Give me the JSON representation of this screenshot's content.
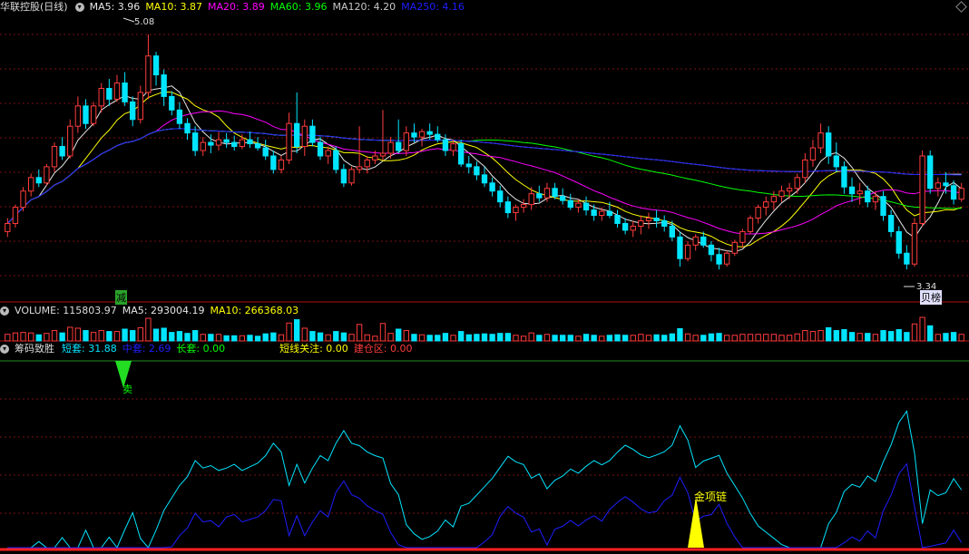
{
  "header": {
    "stock_name": "华联控股(日线)",
    "ma5_label": "MA5: 3.96",
    "ma10_label": "MA10: 3.87",
    "ma20_label": "MA20: 3.89",
    "ma60_label": "MA60: 3.96",
    "ma120_label": "MA120: 4.20",
    "ma250_label": "MA250: 4.16"
  },
  "price_panel": {
    "high_label": "5.08",
    "low_label": "3.34",
    "sell_marker_label": "减",
    "buy_marker_label": "贝榜"
  },
  "volume_panel": {
    "volume_label": "VOLUME: 115803.97",
    "ma5_label": "MA5: 293004.19",
    "ma10_label": "MA10: 266368.03"
  },
  "indicator_panel": {
    "name": "筹码致胜",
    "short_label": "短套: 31.88",
    "mid_label": "中套: 2.69",
    "long_label": "长套: 0.00",
    "focus_label": "短线关注: 0.00",
    "build_label": "建仓区: 0.00",
    "sell_signal_label": "卖",
    "golden_label": "金项链"
  },
  "colors": {
    "up": "#ff3c3c",
    "down": "#00e5ff",
    "ma5": "#e6e6e6",
    "ma10": "#ffff00",
    "ma20": "#ff00ff",
    "ma60": "#00ff00",
    "ma120": "#c8c8c8",
    "ma250": "#1e1eff",
    "short": "#00e5ff",
    "mid": "#1e1eff",
    "long": "#00ff00"
  },
  "chart_data": {
    "type": "candlestick",
    "ylim": [
      3.2,
      5.2
    ],
    "ohlc": [
      [
        3.62,
        3.72,
        3.58,
        3.68
      ],
      [
        3.68,
        3.82,
        3.65,
        3.8
      ],
      [
        3.8,
        3.95,
        3.77,
        3.92
      ],
      [
        3.92,
        4.05,
        3.88,
        4.02
      ],
      [
        4.02,
        4.08,
        3.95,
        3.98
      ],
      [
        3.98,
        4.12,
        3.96,
        4.1
      ],
      [
        4.1,
        4.28,
        4.06,
        4.25
      ],
      [
        4.25,
        4.32,
        4.15,
        4.18
      ],
      [
        4.18,
        4.45,
        4.16,
        4.4
      ],
      [
        4.4,
        4.62,
        4.35,
        4.55
      ],
      [
        4.55,
        4.6,
        4.38,
        4.42
      ],
      [
        4.42,
        4.58,
        4.4,
        4.55
      ],
      [
        4.55,
        4.72,
        4.5,
        4.68
      ],
      [
        4.68,
        4.75,
        4.55,
        4.6
      ],
      [
        4.6,
        4.78,
        4.58,
        4.72
      ],
      [
        4.72,
        4.8,
        4.55,
        4.58
      ],
      [
        4.58,
        4.62,
        4.4,
        4.45
      ],
      [
        4.45,
        4.7,
        4.42,
        4.65
      ],
      [
        4.65,
        5.08,
        4.6,
        4.92
      ],
      [
        4.92,
        4.95,
        4.7,
        4.78
      ],
      [
        4.78,
        4.82,
        4.55,
        4.62
      ],
      [
        4.62,
        4.66,
        4.48,
        4.52
      ],
      [
        4.52,
        4.58,
        4.38,
        4.42
      ],
      [
        4.42,
        4.46,
        4.3,
        4.35
      ],
      [
        4.35,
        4.4,
        4.18,
        4.22
      ],
      [
        4.22,
        4.32,
        4.18,
        4.28
      ],
      [
        4.28,
        4.34,
        4.2,
        4.26
      ],
      [
        4.26,
        4.36,
        4.22,
        4.3
      ],
      [
        4.3,
        4.35,
        4.24,
        4.28
      ],
      [
        4.28,
        4.33,
        4.22,
        4.25
      ],
      [
        4.25,
        4.34,
        4.23,
        4.3
      ],
      [
        4.3,
        4.36,
        4.24,
        4.27
      ],
      [
        4.27,
        4.32,
        4.22,
        4.24
      ],
      [
        4.24,
        4.3,
        4.15,
        4.18
      ],
      [
        4.18,
        4.22,
        4.05,
        4.08
      ],
      [
        4.08,
        4.18,
        4.05,
        4.15
      ],
      [
        4.15,
        4.5,
        4.12,
        4.42
      ],
      [
        4.42,
        4.65,
        4.2,
        4.25
      ],
      [
        4.25,
        4.45,
        4.18,
        4.4
      ],
      [
        4.4,
        4.45,
        4.25,
        4.28
      ],
      [
        4.28,
        4.32,
        4.15,
        4.18
      ],
      [
        4.18,
        4.25,
        4.12,
        4.22
      ],
      [
        4.22,
        4.25,
        4.05,
        4.08
      ],
      [
        4.08,
        4.12,
        3.95,
        3.98
      ],
      [
        3.98,
        4.1,
        3.96,
        4.08
      ],
      [
        4.08,
        4.4,
        4.05,
        4.1
      ],
      [
        4.1,
        4.18,
        4.05,
        4.15
      ],
      [
        4.15,
        4.22,
        4.12,
        4.18
      ],
      [
        4.18,
        4.52,
        4.15,
        4.2
      ],
      [
        4.2,
        4.32,
        4.16,
        4.28
      ],
      [
        4.28,
        4.45,
        4.2,
        4.22
      ],
      [
        4.22,
        4.4,
        4.18,
        4.35
      ],
      [
        4.35,
        4.42,
        4.28,
        4.32
      ],
      [
        4.32,
        4.38,
        4.25,
        4.36
      ],
      [
        4.36,
        4.42,
        4.3,
        4.34
      ],
      [
        4.34,
        4.4,
        4.28,
        4.3
      ],
      [
        4.3,
        4.34,
        4.18,
        4.22
      ],
      [
        4.22,
        4.3,
        4.18,
        4.27
      ],
      [
        4.27,
        4.3,
        4.1,
        4.12
      ],
      [
        4.12,
        4.18,
        4.05,
        4.1
      ],
      [
        4.1,
        4.14,
        4.0,
        4.04
      ],
      [
        4.04,
        4.1,
        3.95,
        3.98
      ],
      [
        3.98,
        4.02,
        3.88,
        3.92
      ],
      [
        3.92,
        3.96,
        3.8,
        3.84
      ],
      [
        3.84,
        3.88,
        3.72,
        3.76
      ],
      [
        3.76,
        3.82,
        3.7,
        3.8
      ],
      [
        3.8,
        3.86,
        3.76,
        3.82
      ],
      [
        3.82,
        3.95,
        3.78,
        3.9
      ],
      [
        3.9,
        3.96,
        3.84,
        3.87
      ],
      [
        3.87,
        3.98,
        3.84,
        3.94
      ],
      [
        3.94,
        3.98,
        3.86,
        3.88
      ],
      [
        3.88,
        3.94,
        3.82,
        3.85
      ],
      [
        3.85,
        3.9,
        3.78,
        3.8
      ],
      [
        3.8,
        3.86,
        3.76,
        3.83
      ],
      [
        3.83,
        3.88,
        3.74,
        3.78
      ],
      [
        3.78,
        3.82,
        3.7,
        3.74
      ],
      [
        3.74,
        3.8,
        3.7,
        3.77
      ],
      [
        3.77,
        3.84,
        3.72,
        3.74
      ],
      [
        3.74,
        3.78,
        3.65,
        3.68
      ],
      [
        3.68,
        3.72,
        3.6,
        3.63
      ],
      [
        3.63,
        3.7,
        3.58,
        3.66
      ],
      [
        3.66,
        3.74,
        3.6,
        3.7
      ],
      [
        3.7,
        3.76,
        3.64,
        3.72
      ],
      [
        3.72,
        3.78,
        3.65,
        3.7
      ],
      [
        3.7,
        3.74,
        3.62,
        3.66
      ],
      [
        3.66,
        3.7,
        3.55,
        3.58
      ],
      [
        3.58,
        3.62,
        3.36,
        3.42
      ],
      [
        3.42,
        3.55,
        3.4,
        3.52
      ],
      [
        3.52,
        3.6,
        3.48,
        3.58
      ],
      [
        3.58,
        3.62,
        3.5,
        3.52
      ],
      [
        3.52,
        3.55,
        3.4,
        3.45
      ],
      [
        3.45,
        3.5,
        3.34,
        3.38
      ],
      [
        3.38,
        3.48,
        3.36,
        3.46
      ],
      [
        3.46,
        3.56,
        3.44,
        3.54
      ],
      [
        3.54,
        3.64,
        3.5,
        3.62
      ],
      [
        3.62,
        3.74,
        3.6,
        3.72
      ],
      [
        3.72,
        3.82,
        3.68,
        3.8
      ],
      [
        3.8,
        3.88,
        3.74,
        3.84
      ],
      [
        3.84,
        3.92,
        3.78,
        3.88
      ],
      [
        3.88,
        3.96,
        3.84,
        3.92
      ],
      [
        3.92,
        3.98,
        3.86,
        3.94
      ],
      [
        3.94,
        4.05,
        3.9,
        4.02
      ],
      [
        4.02,
        4.2,
        3.98,
        4.15
      ],
      [
        4.15,
        4.3,
        4.1,
        4.24
      ],
      [
        4.24,
        4.42,
        4.2,
        4.35
      ],
      [
        4.35,
        4.4,
        4.12,
        4.18
      ],
      [
        4.18,
        4.28,
        4.06,
        4.1
      ],
      [
        4.1,
        4.14,
        3.9,
        3.95
      ],
      [
        3.95,
        4.02,
        3.84,
        3.9
      ],
      [
        3.9,
        3.98,
        3.82,
        3.92
      ],
      [
        3.92,
        3.96,
        3.8,
        3.84
      ],
      [
        3.84,
        3.92,
        3.78,
        3.88
      ],
      [
        3.88,
        3.92,
        3.7,
        3.74
      ],
      [
        3.74,
        3.78,
        3.58,
        3.62
      ],
      [
        3.62,
        3.66,
        3.42,
        3.46
      ],
      [
        3.46,
        3.52,
        3.34,
        3.38
      ],
      [
        3.38,
        3.72,
        3.36,
        3.68
      ],
      [
        3.68,
        4.22,
        3.66,
        4.18
      ],
      [
        4.18,
        4.22,
        3.9,
        3.94
      ],
      [
        3.94,
        4.02,
        3.88,
        3.98
      ],
      [
        3.98,
        4.06,
        3.9,
        3.96
      ],
      [
        3.96,
        4.0,
        3.82,
        3.86
      ],
      [
        3.86,
        3.98,
        3.84,
        3.94
      ]
    ],
    "volume_scale_max": 600000
  }
}
